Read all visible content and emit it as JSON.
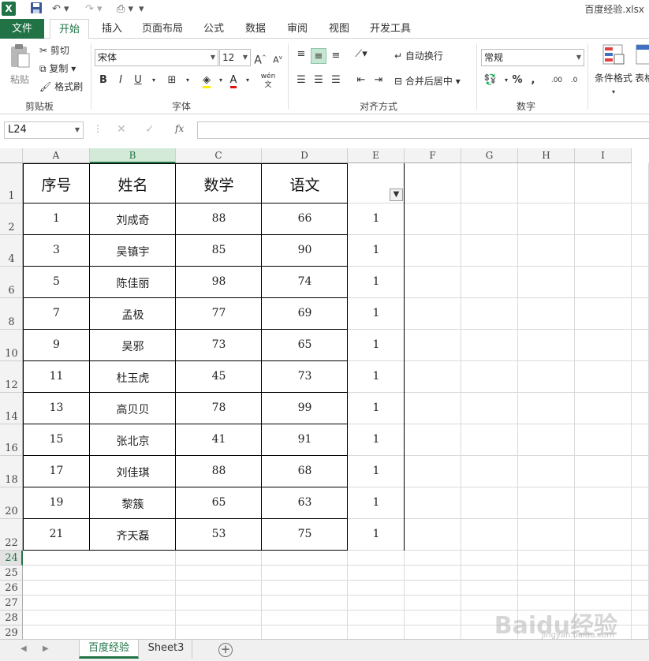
{
  "window": {
    "title": "百度经验.xlsx",
    "app_icon": "X"
  },
  "ribbon_tabs": [
    {
      "label": "文件"
    },
    {
      "label": "开始"
    },
    {
      "label": "插入"
    },
    {
      "label": "页面布局"
    },
    {
      "label": "公式"
    },
    {
      "label": "数据"
    },
    {
      "label": "审阅"
    },
    {
      "label": "视图"
    },
    {
      "label": "开发工具"
    }
  ],
  "ribbon": {
    "clipboard": {
      "paste": "粘贴",
      "cut": "剪切",
      "copy": "复制",
      "format_painter": "格式刷",
      "group": "剪贴板"
    },
    "font": {
      "name": "宋体",
      "size": "12",
      "bold": "B",
      "italic": "I",
      "underline": "U",
      "grow": "A",
      "shrink": "A",
      "phonetic": "wén",
      "group": "字体"
    },
    "alignment": {
      "wrap": "自动换行",
      "merge": "合并后居中",
      "group": "对齐方式"
    },
    "number": {
      "format": "常规",
      "percent": "%",
      "comma": ",",
      "group": "数字"
    },
    "styles": {
      "conditional": "条件格式",
      "table": "表格"
    }
  },
  "formula_bar": {
    "name_box": "L24",
    "fx": "fx",
    "value": ""
  },
  "columns": [
    "A",
    "B",
    "C",
    "D",
    "E",
    "F",
    "G",
    "H",
    "I"
  ],
  "selected_column": "B",
  "header_row": {
    "row": "1",
    "cells": [
      "序号",
      "姓名",
      "数学",
      "语文",
      ""
    ]
  },
  "rows": [
    {
      "row": "2",
      "cells": [
        "1",
        "刘成奇",
        "88",
        "66",
        "1"
      ]
    },
    {
      "row": "4",
      "cells": [
        "3",
        "吴镇宇",
        "85",
        "90",
        "1"
      ]
    },
    {
      "row": "6",
      "cells": [
        "5",
        "陈佳丽",
        "98",
        "74",
        "1"
      ]
    },
    {
      "row": "8",
      "cells": [
        "7",
        "孟极",
        "77",
        "69",
        "1"
      ]
    },
    {
      "row": "10",
      "cells": [
        "9",
        "吴邪",
        "73",
        "65",
        "1"
      ]
    },
    {
      "row": "12",
      "cells": [
        "11",
        "杜玉虎",
        "45",
        "73",
        "1"
      ]
    },
    {
      "row": "14",
      "cells": [
        "13",
        "高贝贝",
        "78",
        "99",
        "1"
      ]
    },
    {
      "row": "16",
      "cells": [
        "15",
        "张北京",
        "41",
        "91",
        "1"
      ]
    },
    {
      "row": "18",
      "cells": [
        "17",
        "刘佳琪",
        "88",
        "68",
        "1"
      ]
    },
    {
      "row": "20",
      "cells": [
        "19",
        "黎簇",
        "65",
        "63",
        "1"
      ]
    },
    {
      "row": "22",
      "cells": [
        "21",
        "齐天磊",
        "53",
        "75",
        "1"
      ]
    }
  ],
  "empty_rows": [
    "24",
    "25",
    "26",
    "27",
    "28",
    "29"
  ],
  "selected_row": "24",
  "sheets": [
    {
      "label": "百度经验",
      "active": true
    },
    {
      "label": "Sheet3",
      "active": false
    }
  ],
  "watermark": {
    "main": "Baidu经验",
    "sub": "jingyan.baidu.com"
  },
  "accent_color": "#217346"
}
